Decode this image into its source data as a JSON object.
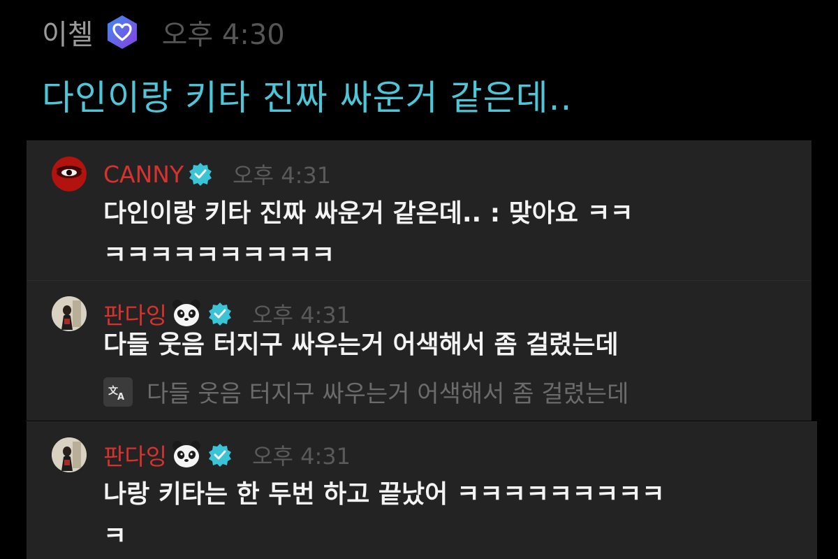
{
  "top_message": {
    "name": "이첼",
    "badge_icon": "heart-hexagon-badge-icon",
    "time": "오후 4:30",
    "text": "다인이랑 키타 진짜 싸운거 같은데..",
    "text_color": "#4fc6d8"
  },
  "replies": [
    {
      "name": "CANNY",
      "avatar_icon": "canny-avatar",
      "verified_icon": "verified-badge-icon",
      "time": "오후 4:31",
      "line1": "다인이랑 키타 진짜 싸운거 같은데..   : 맞아요 ㅋㅋ",
      "line2": "ㅋㅋㅋㅋㅋㅋㅋㅋㅋㅋ"
    },
    {
      "name": "판다잉",
      "avatar_icon": "pandaing-avatar",
      "emoji_icon": "panda-face-emoji-icon",
      "verified_icon": "verified-badge-icon",
      "time": "오후 4:31",
      "line1": "다들 웃음 터지구 싸우는거 어색해서 좀 걸렸는데",
      "translate_icon": "translate-icon",
      "translation": "다들 웃음 터지구 싸우는거 어색해서 좀 걸렸는데"
    },
    {
      "name": "판다잉",
      "avatar_icon": "pandaing-avatar",
      "emoji_icon": "panda-face-emoji-icon",
      "verified_icon": "verified-badge-icon",
      "time": "오후 4:31",
      "line1": "나랑 키타는 한 두번 하고 끝났어 ㅋㅋㅋㅋㅋㅋㅋㅋㅋ",
      "line2": "ㅋ"
    }
  ],
  "colors": {
    "background": "#000000",
    "reply_background": "#232323",
    "name_red": "#d8322f",
    "verified_teal": "#3bc3d6",
    "badge_purple": "#6a52e6"
  }
}
